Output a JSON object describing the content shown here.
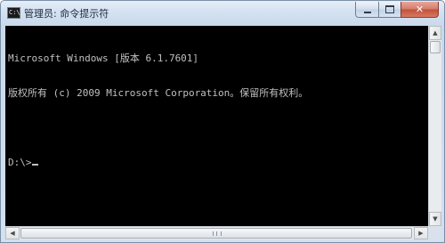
{
  "window": {
    "title": "管理员: 命令提示符",
    "icon": "cmd-icon",
    "icon_glyph": "C:\\",
    "buttons": {
      "minimize": "minimize-icon",
      "maximize": "maximize-icon",
      "close": "close-icon",
      "close_glyph": "✕"
    }
  },
  "console": {
    "lines": [
      "Microsoft Windows [版本 6.1.7601]",
      "版权所有 (c) 2009 Microsoft Corporation。保留所有权利。",
      "",
      "D:\\>"
    ],
    "background": "#000000",
    "foreground": "#c0c0c0"
  },
  "scrollbars": {
    "up_arrow": "▲",
    "down_arrow": "▼",
    "left_arrow": "◀",
    "right_arrow": "▶"
  }
}
